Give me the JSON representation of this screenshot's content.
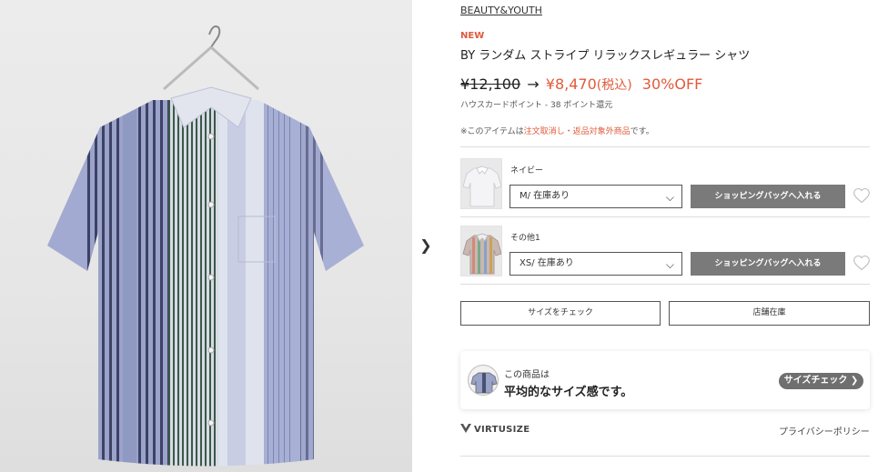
{
  "product": {
    "brand": "BEAUTY&YOUTH",
    "badge": "NEW",
    "title": "BY ランダム ストライプ リラックスレギュラー シャツ",
    "price_old": "¥12,100",
    "price_arrow": "→",
    "price_new": "¥8,470",
    "price_tax": "(税込)",
    "discount": "30%OFF",
    "points": "ハウスカードポイント - 38 ポイント還元",
    "notice_prefix": "※このアイテムは",
    "notice_link": "注文取消し・返品対象外商品",
    "notice_suffix": "です。"
  },
  "variants": [
    {
      "color": "ネイビー",
      "size": "M/ 在庫あり",
      "cart_label": "ショッピングバッグへ入れる"
    },
    {
      "color": "その他1",
      "size": "XS/ 在庫あり",
      "cart_label": "ショッピングバッグへ入れる"
    }
  ],
  "actions": {
    "size_check": "サイズをチェック",
    "store_stock": "店舗在庫"
  },
  "virtusize": {
    "small": "この商品は",
    "big": "平均的なサイズ感です。",
    "button": "サイズチェック ❯",
    "logo": "VIRTUSIZE",
    "privacy": "プライバシーポリシー"
  },
  "colors": {
    "accent": "#e05a3a",
    "button_gray": "#7a7a7a"
  },
  "icons": {
    "next": "chevron-right-icon",
    "heart": "heart-icon",
    "dropdown": "chevron-down-icon"
  }
}
